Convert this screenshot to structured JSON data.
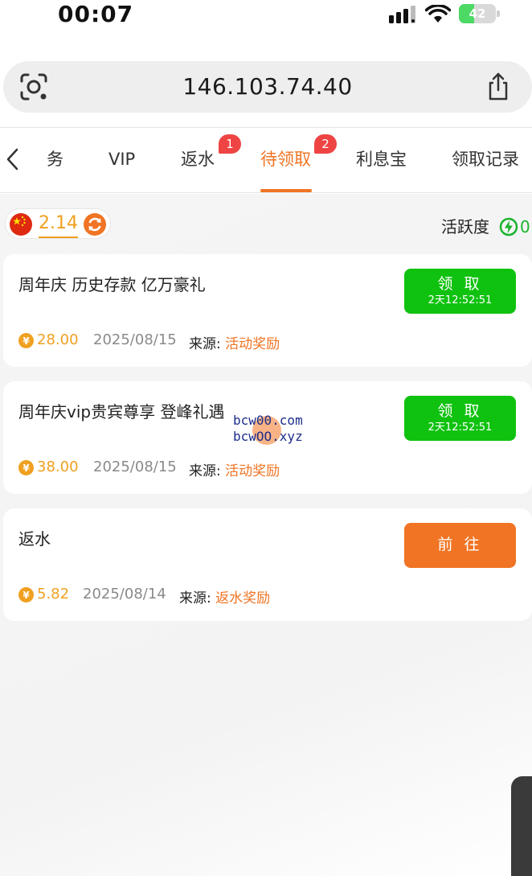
{
  "status_bar": {
    "time": "00:07",
    "battery": "42",
    "battery_level": 0.42
  },
  "address_bar": {
    "url": "146.103.74.40"
  },
  "tabs": [
    {
      "label": "务",
      "active": false,
      "badge": ""
    },
    {
      "label": "VIP",
      "active": false,
      "badge": ""
    },
    {
      "label": "返水",
      "active": false,
      "badge": "1"
    },
    {
      "label": "待领取",
      "active": true,
      "badge": "2"
    },
    {
      "label": "利息宝",
      "active": false,
      "badge": ""
    },
    {
      "label": "领取记录",
      "active": false,
      "badge": ""
    }
  ],
  "balance": {
    "value": "2.14"
  },
  "activity": {
    "label": "活跃度",
    "value": "0"
  },
  "cards": [
    {
      "title": "周年庆 历史存款 亿万豪礼",
      "amount": "28.00",
      "date": "2025/08/15",
      "source_label": "来源:",
      "source_value": "活动奖励",
      "button_label": "领 取",
      "button_sub": "2天12:52:51"
    },
    {
      "title": "周年庆vip贵宾尊享 登峰礼遇",
      "amount": "38.00",
      "date": "2025/08/15",
      "source_label": "来源:",
      "source_value": "活动奖励",
      "button_label": "领 取",
      "button_sub": "2天12:52:51"
    },
    {
      "title": "返水",
      "amount": "5.82",
      "date": "2025/08/14",
      "source_label": "来源:",
      "source_value": "返水奖励",
      "button_label": "前 往",
      "button_sub": ""
    }
  ],
  "watermark": {
    "line1": "bcw00.com",
    "line2": "bcwOO.xyz"
  },
  "colors": {
    "accent": "#f07423",
    "green": "#10c210",
    "gold": "#f0a020",
    "badge": "#ef4444"
  },
  "icons": {
    "status": [
      "signal-icon",
      "wifi-icon",
      "battery-icon"
    ],
    "address": [
      "lens-icon",
      "share-icon"
    ],
    "nav": [
      "back-icon"
    ],
    "balance": [
      "china-flag-icon",
      "refresh-icon"
    ],
    "activity": "bolt-icon",
    "coin": "yuan-coin-icon"
  }
}
